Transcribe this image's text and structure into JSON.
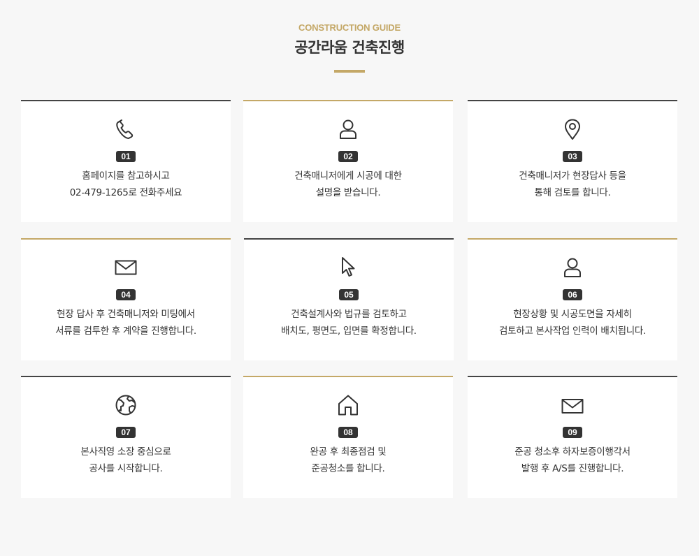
{
  "header": {
    "eyebrow": "CONSTRUCTION GUIDE",
    "title": "공간라움 건축진행"
  },
  "colors": {
    "accent": "#c4a867",
    "dark": "#444444",
    "badge": "#333333"
  },
  "steps": [
    {
      "number": "01",
      "icon": "phone-icon",
      "line1": "홈페이지를 참고하시고",
      "line2": "02-479-1265로 전화주세요"
    },
    {
      "number": "02",
      "icon": "user-icon",
      "line1": "건축매니저에게 시공에 대한",
      "line2": "설명을 받습니다."
    },
    {
      "number": "03",
      "icon": "map-pin-icon",
      "line1": "건축매니저가 현장답사 등을",
      "line2": "통해 검토를 합니다."
    },
    {
      "number": "04",
      "icon": "mail-icon",
      "line1": "현장 답사 후 건축매니저와 미팅에서",
      "line2": "서류를 검투한 후 계약을 진행합니다."
    },
    {
      "number": "05",
      "icon": "cursor-icon",
      "line1": "건축설계사와 법규를 검토하고",
      "line2": "배치도, 평면도, 입면를 확정합니다."
    },
    {
      "number": "06",
      "icon": "user-icon",
      "line1": "현장상황 및 시공도면을 자세히",
      "line2": "검토하고 본사작업 인력이 배치됩니다."
    },
    {
      "number": "07",
      "icon": "globe-icon",
      "line1": "본사직영 소장 중심으로",
      "line2": "공사를 시작합니다."
    },
    {
      "number": "08",
      "icon": "home-icon",
      "line1": "완공 후 최종점검 및",
      "line2": "준공청소를 합니다."
    },
    {
      "number": "09",
      "icon": "mail-icon",
      "line1": "준공 청소후 하자보증이행각서",
      "line2": "발행 후 A/S를 진행합니다."
    }
  ]
}
